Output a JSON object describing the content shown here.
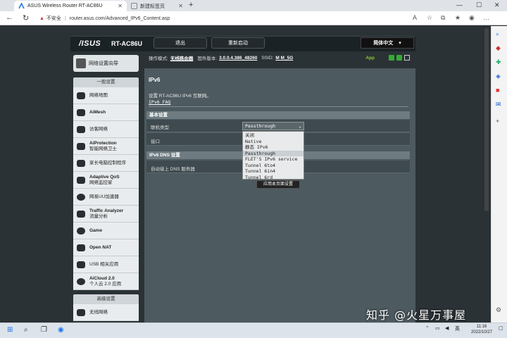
{
  "browser": {
    "tabs": [
      {
        "label": "ASUS Wireless Router RT-AC86U",
        "active": true
      },
      {
        "label": "新建标签页",
        "active": false
      }
    ],
    "new_tab": "+",
    "url_warning": "不安全",
    "url": "router.asus.com/Advanced_IPv6_Content.asp"
  },
  "router": {
    "logo": "/ISUS",
    "model": "RT-AC86U",
    "logout_label": "退出",
    "reboot_label": "重新启动",
    "language": "简体中文",
    "status": {
      "mode_label": "操作模式:",
      "mode_value": "无线路由器",
      "firmware_label": "固件版本:",
      "firmware_value": "3.0.0.4.386_48260",
      "ssid_label": "SSID:",
      "ssid_value": "M  M_5G",
      "app_label": "App"
    }
  },
  "sidebar": {
    "qis_label": "网络设置向导",
    "general_title": "一般设置",
    "general_items": [
      {
        "icon": "network-map-icon",
        "label": "网络地图",
        "sub": ""
      },
      {
        "icon": "aimesh-icon",
        "label": "AiMesh",
        "sub": ""
      },
      {
        "icon": "guest-network-icon",
        "label": "访客网络",
        "sub": ""
      },
      {
        "icon": "aiprotection-icon",
        "label": "AiProtection",
        "sub": "智能网络卫士"
      },
      {
        "icon": "parental-controls-icon",
        "label": "家长电脑控制程序",
        "sub": ""
      },
      {
        "icon": "qos-icon",
        "label": "Adaptive QoS",
        "sub": "网络监控家"
      },
      {
        "icon": "uu-accelerator-icon",
        "label": "网易UU加速器",
        "sub": ""
      },
      {
        "icon": "traffic-analyzer-icon",
        "label": "Traffic Analyzer",
        "sub": "流量分析"
      },
      {
        "icon": "game-icon",
        "label": "Game",
        "sub": ""
      },
      {
        "icon": "open-nat-icon",
        "label": "Open NAT",
        "sub": ""
      },
      {
        "icon": "usb-icon",
        "label": "USB 相关应用",
        "sub": ""
      },
      {
        "icon": "aicloud-icon",
        "label": "AiCloud 2.0",
        "sub": "个人云 2.0 应用"
      }
    ],
    "advanced_title": "高级设置",
    "advanced_items": [
      {
        "icon": "wireless-icon",
        "label": "无线网络",
        "sub": ""
      }
    ]
  },
  "content": {
    "title": "IPv6",
    "description": "设置 RT-AC86U IPv6 互联网。",
    "faq_link": "IPv6 FAQ",
    "basic_header": "基本设置",
    "connection_type_label": "联机类型",
    "interface_label": "接口",
    "selected_type": "Passthrough",
    "dropdown_options": [
      "关闭",
      "Native",
      "静态 IPv6",
      "Passthrough",
      "FLET'S IPv6 service",
      "Tunnel 6to4",
      "Tunnel 6in4",
      "Tunnel 6rd"
    ],
    "dns_header": "IPv6 DNS 设置",
    "dns_auto_label": "自动接上 DNS 服务器",
    "apply_label": "应用本页面设置"
  },
  "watermark": "知乎 @火星万事屋",
  "taskbar": {
    "language": "英",
    "time": "11:16",
    "date": "2022/10/27"
  },
  "colors": {
    "page_bg": "#2b3236",
    "panel_bg": "#4d5a60",
    "header_row": "#6e7c82",
    "app_green": "#88cc33"
  }
}
